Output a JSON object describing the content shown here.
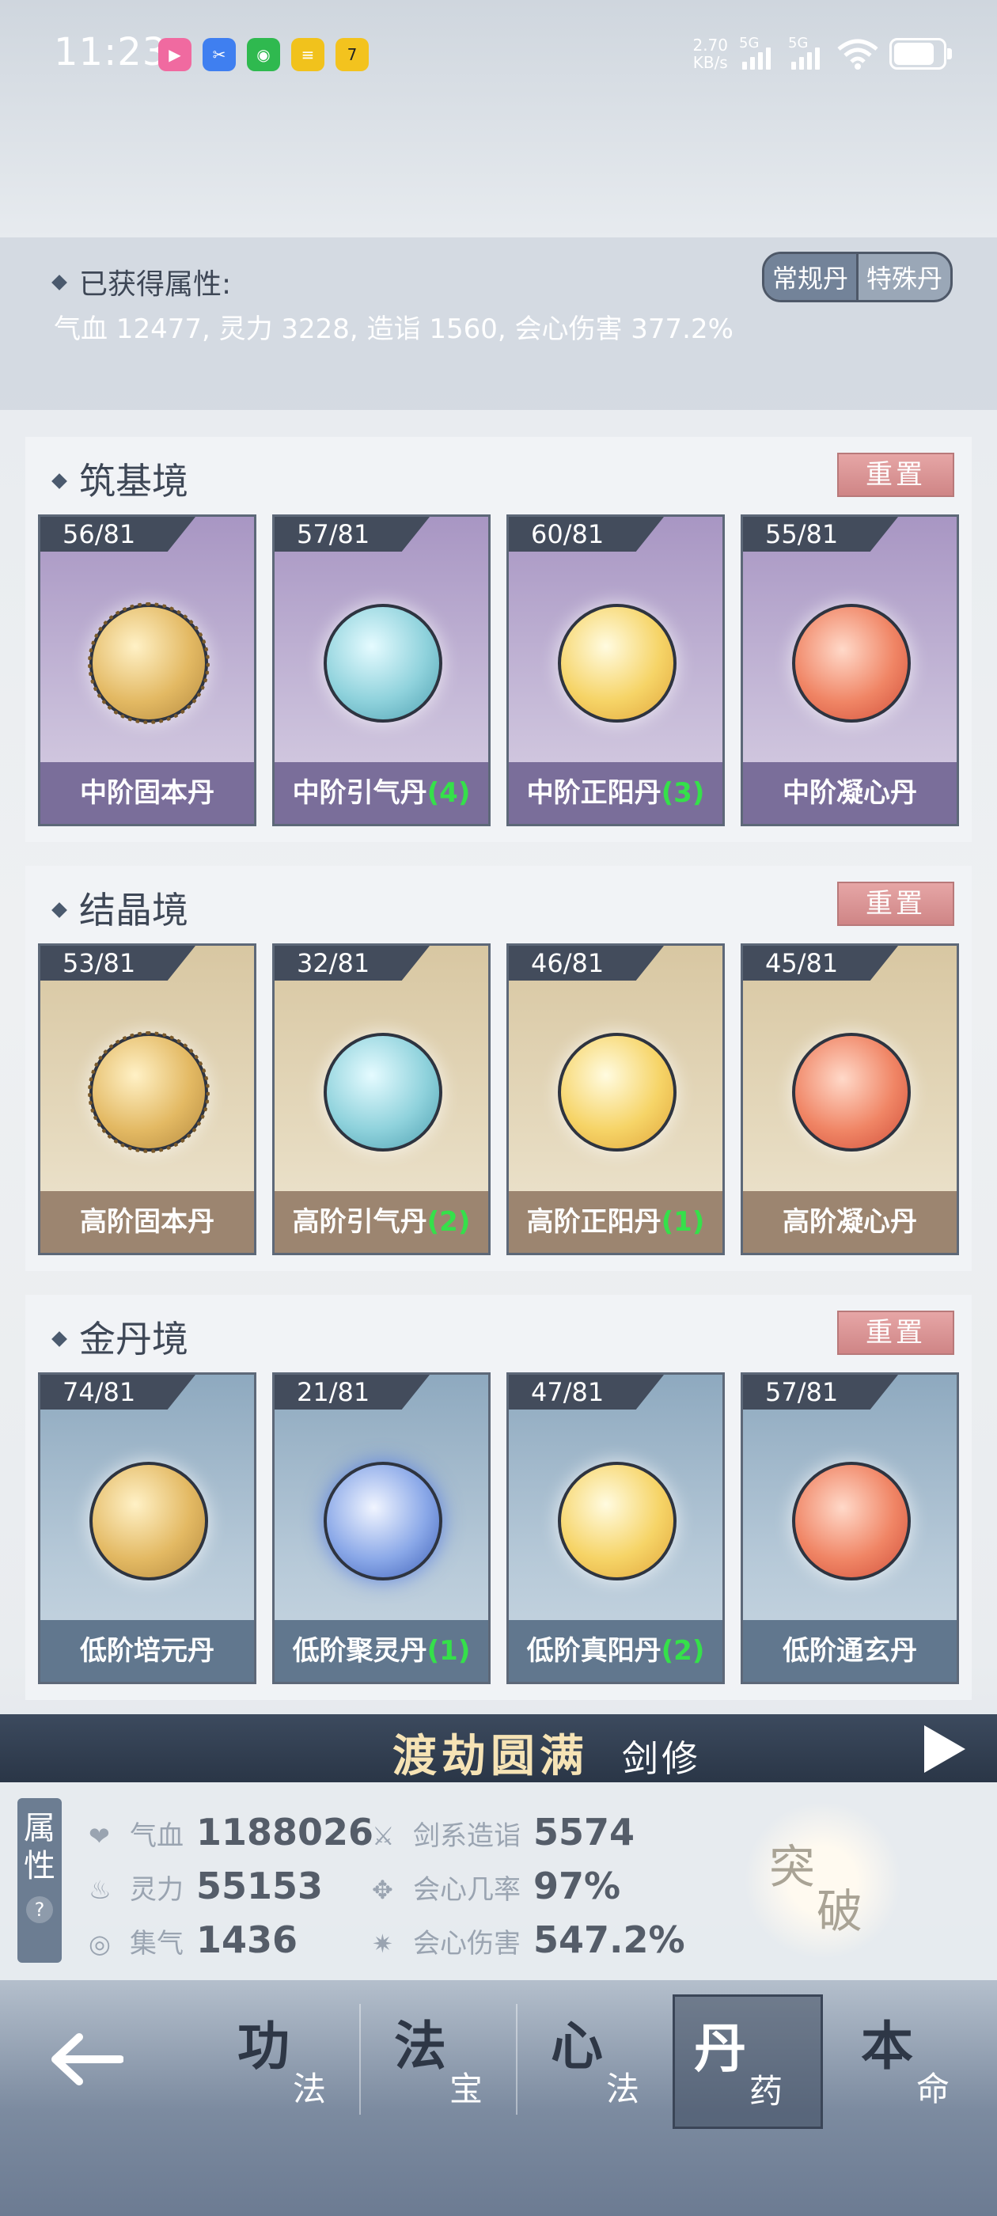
{
  "status_bar": {
    "time": "11:23",
    "net_speed": "2.70",
    "net_unit": "KB/s",
    "signal1": "5G",
    "signal2": "5G",
    "app_icons": [
      "bilibili-icon",
      "scissors-app-icon",
      "wechat-icon",
      "menu-app-icon",
      "7-app-icon"
    ]
  },
  "attributes": {
    "title": "已获得属性:",
    "text": "气血 12477, 灵力 3228, 造诣 1560, 会心伤害 377.2%",
    "tabs": [
      "常规丹",
      "特殊丹"
    ],
    "active_tab": "常规丹"
  },
  "sections": [
    {
      "title": "筑基境",
      "reset_label": "重置",
      "cards": [
        {
          "count": "56/81",
          "name": "中阶固本丹",
          "bonus": ""
        },
        {
          "count": "57/81",
          "name": "中阶引气丹",
          "bonus": "(4)"
        },
        {
          "count": "60/81",
          "name": "中阶正阳丹",
          "bonus": "(3)"
        },
        {
          "count": "55/81",
          "name": "中阶凝心丹",
          "bonus": ""
        }
      ]
    },
    {
      "title": "结晶境",
      "reset_label": "重置",
      "cards": [
        {
          "count": "53/81",
          "name": "高阶固本丹",
          "bonus": ""
        },
        {
          "count": "32/81",
          "name": "高阶引气丹",
          "bonus": "(2)"
        },
        {
          "count": "46/81",
          "name": "高阶正阳丹",
          "bonus": "(1)"
        },
        {
          "count": "45/81",
          "name": "高阶凝心丹",
          "bonus": ""
        }
      ]
    },
    {
      "title": "金丹境",
      "reset_label": "重置",
      "cards": [
        {
          "count": "74/81",
          "name": "低阶培元丹",
          "bonus": ""
        },
        {
          "count": "21/81",
          "name": "低阶聚灵丹",
          "bonus": "(1)"
        },
        {
          "count": "47/81",
          "name": "低阶真阳丹",
          "bonus": "(2)"
        },
        {
          "count": "57/81",
          "name": "低阶通玄丹",
          "bonus": ""
        }
      ]
    }
  ],
  "banner": {
    "title": "渡劫圆满",
    "subtitle": "剑修"
  },
  "stats": {
    "tag_line1": "属",
    "tag_line2": "性",
    "help": "?",
    "items": [
      {
        "label": "气血",
        "value": "1188026"
      },
      {
        "label": "灵力",
        "value": "55153"
      },
      {
        "label": "集气",
        "value": "1436"
      },
      {
        "label": "剑系造诣",
        "value": "5574"
      },
      {
        "label": "会心几率",
        "value": "97%"
      },
      {
        "label": "会心伤害",
        "value": "547.2%"
      }
    ],
    "breakthrough_1": "突",
    "breakthrough_2": "破"
  },
  "nav": {
    "items": [
      {
        "big": "功",
        "small": "法"
      },
      {
        "big": "法",
        "small": "宝"
      },
      {
        "big": "心",
        "small": "法"
      },
      {
        "big": "丹",
        "small": "药"
      },
      {
        "big": "本",
        "small": "命"
      }
    ],
    "active": "丹药"
  }
}
